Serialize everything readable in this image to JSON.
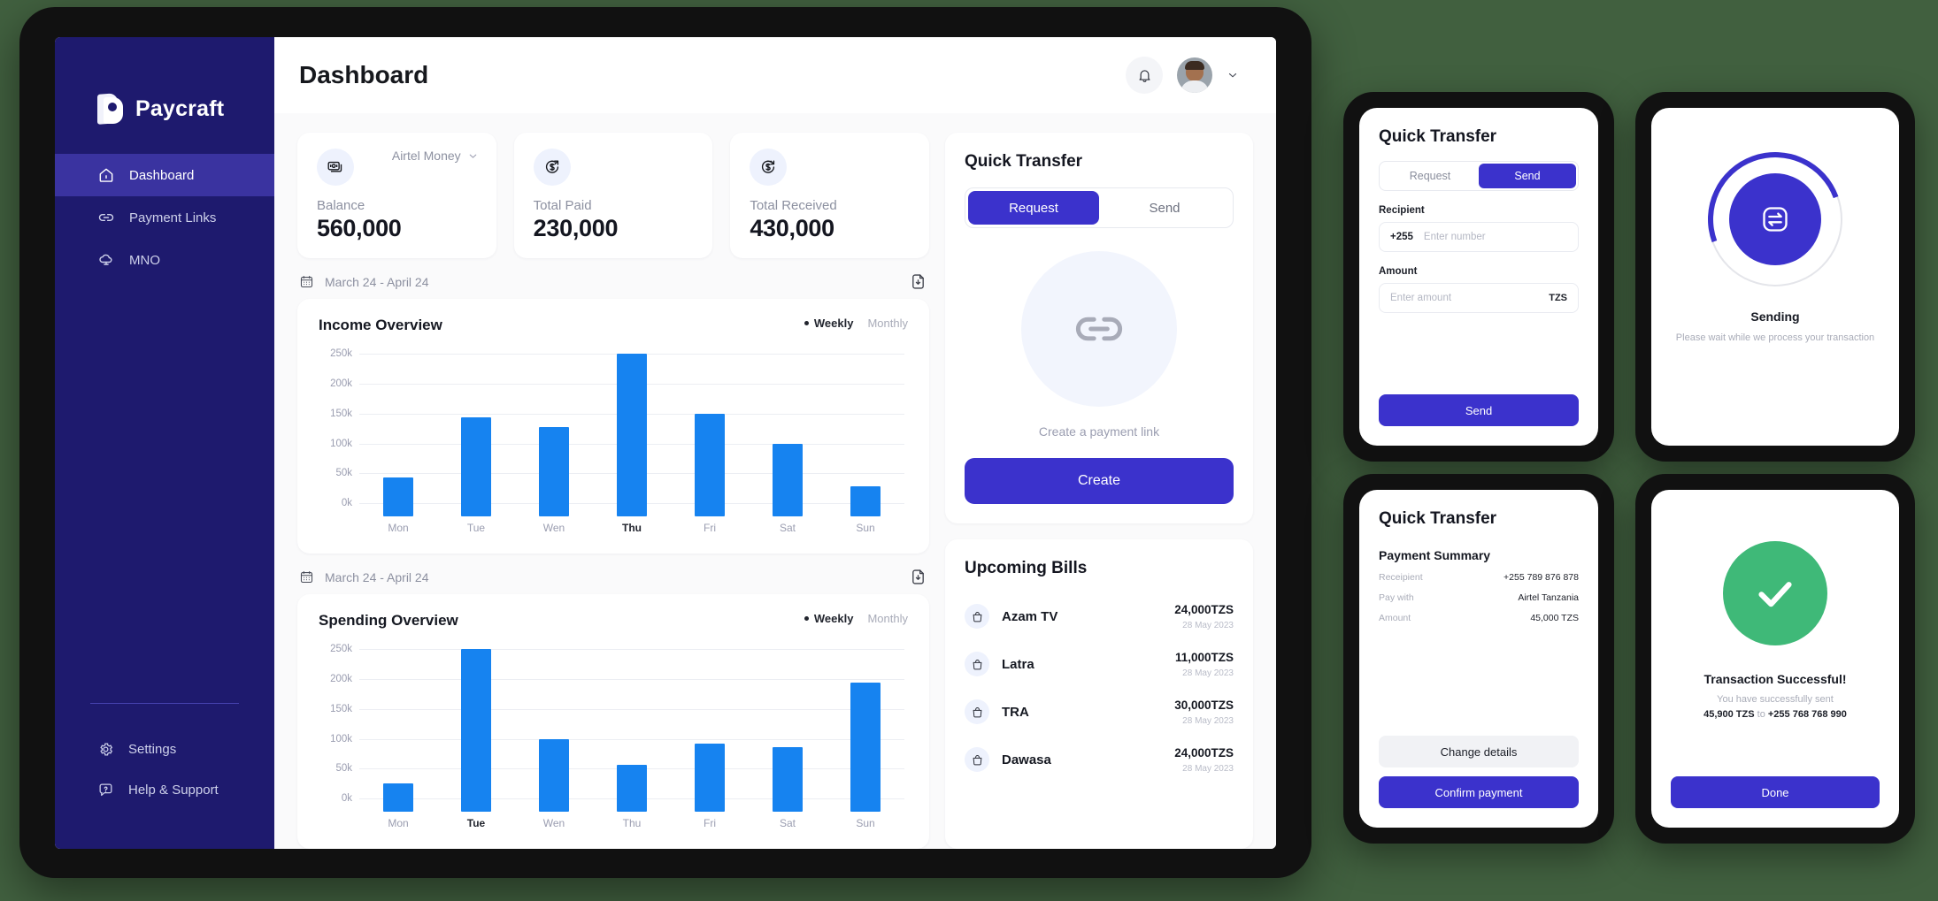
{
  "app": {
    "brand": "Paycraft",
    "page_title": "Dashboard"
  },
  "sidebar": {
    "items": [
      {
        "label": "Dashboard",
        "icon": "home-icon",
        "active": true
      },
      {
        "label": "Payment Links",
        "icon": "link-icon",
        "active": false
      },
      {
        "label": "MNO",
        "icon": "cloud-network-icon",
        "active": false
      }
    ],
    "bottom_items": [
      {
        "label": "Settings",
        "icon": "gear-icon"
      },
      {
        "label": "Help & Support",
        "icon": "help-chat-icon"
      }
    ]
  },
  "topbar": {
    "notification_icon": "bell-icon",
    "avatar": "user-avatar",
    "account_caret": "chevron-down-icon"
  },
  "stats": [
    {
      "label": "Balance",
      "value": "560,000",
      "icon": "banknotes-icon",
      "mno": "Airtel Money"
    },
    {
      "label": "Total Paid",
      "value": "230,000",
      "icon": "money-out-icon"
    },
    {
      "label": "Total Received",
      "value": "430,000",
      "icon": "money-in-icon"
    }
  ],
  "income_block": {
    "date_range": "March 24 - April 24",
    "download_icon": "file-download-icon",
    "calendar_icon": "calendar-icon",
    "title": "Income Overview",
    "toggle_weekly": "Weekly",
    "toggle_monthly": "Monthly"
  },
  "spending_block": {
    "date_range": "March 24 - April 24",
    "download_icon": "file-download-icon",
    "calendar_icon": "calendar-icon",
    "title": "Spending Overview",
    "toggle_weekly": "Weekly",
    "toggle_monthly": "Monthly"
  },
  "quick_transfer": {
    "title": "Quick Transfer",
    "tab_request": "Request",
    "tab_send": "Send",
    "active_tab": "Request",
    "link_icon": "chain-link-icon",
    "caption": "Create a payment link",
    "create_button": "Create"
  },
  "upcoming_bills": {
    "title": "Upcoming Bills",
    "rows": [
      {
        "name": "Azam TV",
        "amount": "24,000TZS",
        "date": "28 May 2023",
        "icon": "bag-icon"
      },
      {
        "name": "Latra",
        "amount": "11,000TZS",
        "date": "28 May 2023",
        "icon": "bag-icon"
      },
      {
        "name": "TRA",
        "amount": "30,000TZS",
        "date": "28 May 2023",
        "icon": "bag-icon"
      },
      {
        "name": "Dawasa",
        "amount": "24,000TZS",
        "date": "28 May 2023",
        "icon": "bag-icon"
      }
    ]
  },
  "phone_send": {
    "title": "Quick Transfer",
    "tab_request": "Request",
    "tab_send": "Send",
    "active_tab": "Send",
    "recipient_label": "Recipient",
    "recipient_prefix": "+255",
    "recipient_placeholder": "Enter number",
    "recipient_value": "",
    "amount_label": "Amount",
    "amount_placeholder": "Enter amount",
    "amount_value": "",
    "amount_currency": "TZS",
    "send_button": "Send"
  },
  "phone_sending": {
    "icon": "transfer-arrows-icon",
    "title": "Sending",
    "subtitle": "Please wait while we process your transaction"
  },
  "phone_summary": {
    "title": "Quick Transfer",
    "section_title": "Payment Summary",
    "rows": [
      {
        "key": "Receipient",
        "value": "+255 789 876 878"
      },
      {
        "key": "Pay with",
        "value": "Airtel Tanzania"
      },
      {
        "key": "Amount",
        "value": "45,000 TZS"
      }
    ],
    "change_button": "Change details",
    "confirm_button": "Confirm payment"
  },
  "phone_success": {
    "icon": "check-icon",
    "title": "Transaction Successful!",
    "subtitle": "You have successfully sent",
    "amount": "45,900 TZS",
    "to_word": " to ",
    "recipient": "+255 768 768 990",
    "done_button": "Done"
  },
  "colors": {
    "sidebar": "#1e1a6e",
    "sidebar_active": "#3a33a0",
    "accent": "#3b32cc",
    "bar": "#1683f0",
    "success": "#3fb978",
    "page_bg": "#41603f"
  },
  "chart_data": [
    {
      "type": "bar",
      "title": "Income Overview",
      "categories": [
        "Mon",
        "Tue",
        "Wen",
        "Thu",
        "Fri",
        "Sat",
        "Sun"
      ],
      "values": [
        43000,
        143000,
        128000,
        250000,
        150000,
        100000,
        28000
      ],
      "highlight_category": "Thu",
      "ytick_labels": [
        "250k",
        "200k",
        "150k",
        "100k",
        "50k",
        "0k"
      ],
      "ytick_values": [
        250000,
        200000,
        150000,
        100000,
        50000,
        0
      ],
      "ylim": [
        -22000,
        262000
      ],
      "xlabel": "",
      "ylabel": "",
      "grid": true,
      "legend": [
        "Weekly",
        "Monthly"
      ],
      "legend_position": "top-right",
      "series_color": "#1683f0"
    },
    {
      "type": "bar",
      "title": "Spending Overview",
      "categories": [
        "Mon",
        "Tue",
        "Wen",
        "Thu",
        "Fri",
        "Sat",
        "Sun"
      ],
      "values": [
        25000,
        250000,
        99000,
        57000,
        92000,
        86000,
        194000
      ],
      "highlight_category": "Tue",
      "ytick_labels": [
        "250k",
        "200k",
        "150k",
        "100k",
        "50k",
        "0k"
      ],
      "ytick_values": [
        250000,
        200000,
        150000,
        100000,
        50000,
        0
      ],
      "ylim": [
        -22000,
        262000
      ],
      "xlabel": "",
      "ylabel": "",
      "grid": true,
      "legend": [
        "Weekly",
        "Monthly"
      ],
      "legend_position": "top-right",
      "series_color": "#1683f0"
    }
  ]
}
